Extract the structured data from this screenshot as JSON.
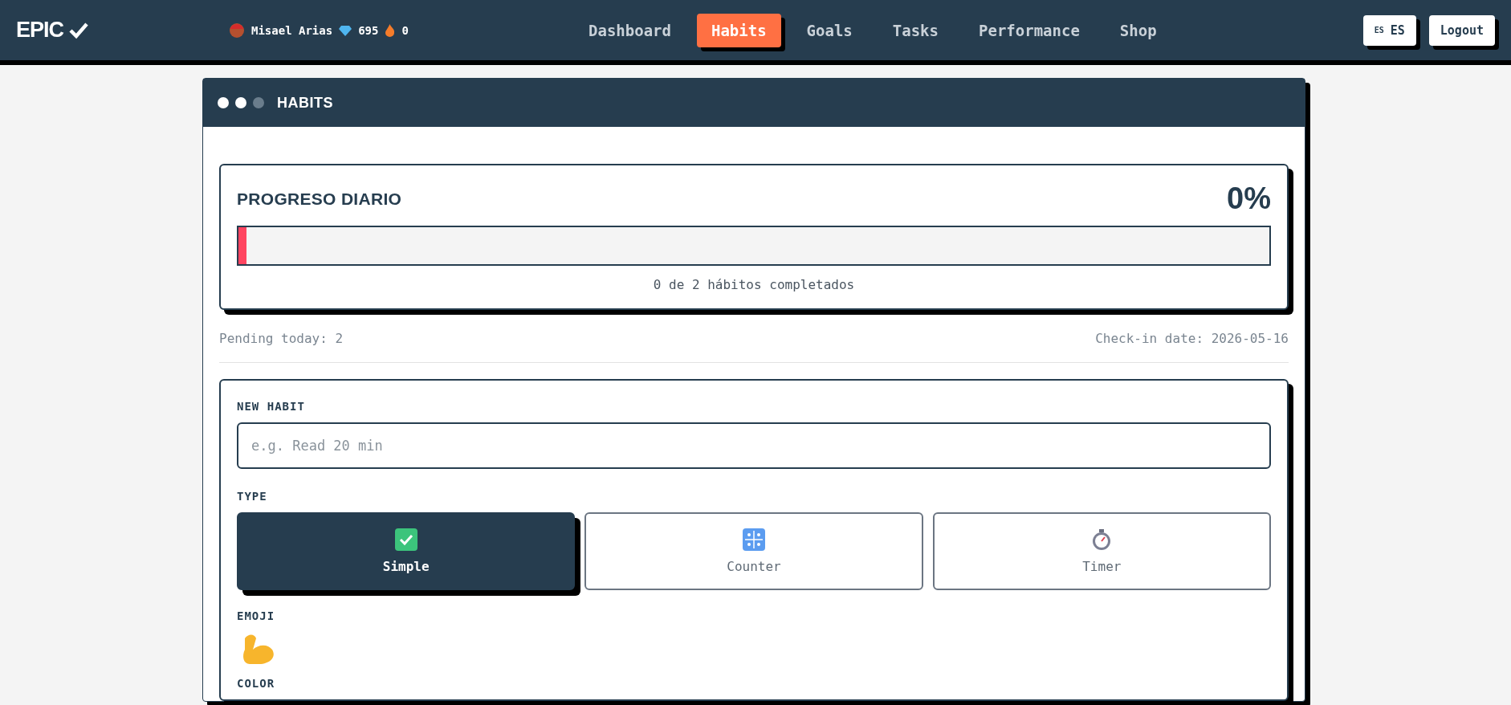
{
  "brand": {
    "logo": "EPIC"
  },
  "user": {
    "name": "Misael Arias",
    "gems": "695",
    "streak": "0"
  },
  "nav": [
    {
      "label": "Dashboard",
      "selected": false
    },
    {
      "label": "Habits",
      "selected": true
    },
    {
      "label": "Goals",
      "selected": false
    },
    {
      "label": "Tasks",
      "selected": false
    },
    {
      "label": "Performance",
      "selected": false
    },
    {
      "label": "Shop",
      "selected": false
    }
  ],
  "language": {
    "flag": "ES",
    "code": "ES"
  },
  "logout": "Logout",
  "panel": {
    "title": "HABITS"
  },
  "progress": {
    "title": "PROGRESO DIARIO",
    "percent": "0%",
    "level": 0.008,
    "caption": "0 de 2 hábitos completados"
  },
  "pending": "Pending today: 2",
  "checkin": "Check-in date: 2026-05-16",
  "form": {
    "name_label": "NEW HABIT",
    "name_placeholder": "e.g. Read 20 min",
    "type_label": "TYPE",
    "types": [
      {
        "kind": "check",
        "label": "Simple",
        "selected": true
      },
      {
        "kind": "counter",
        "label": "Counter",
        "selected": false
      },
      {
        "kind": "timer",
        "label": "Timer",
        "selected": false
      }
    ],
    "emoji_label": "EMOJI",
    "color_label": "COLOR"
  }
}
